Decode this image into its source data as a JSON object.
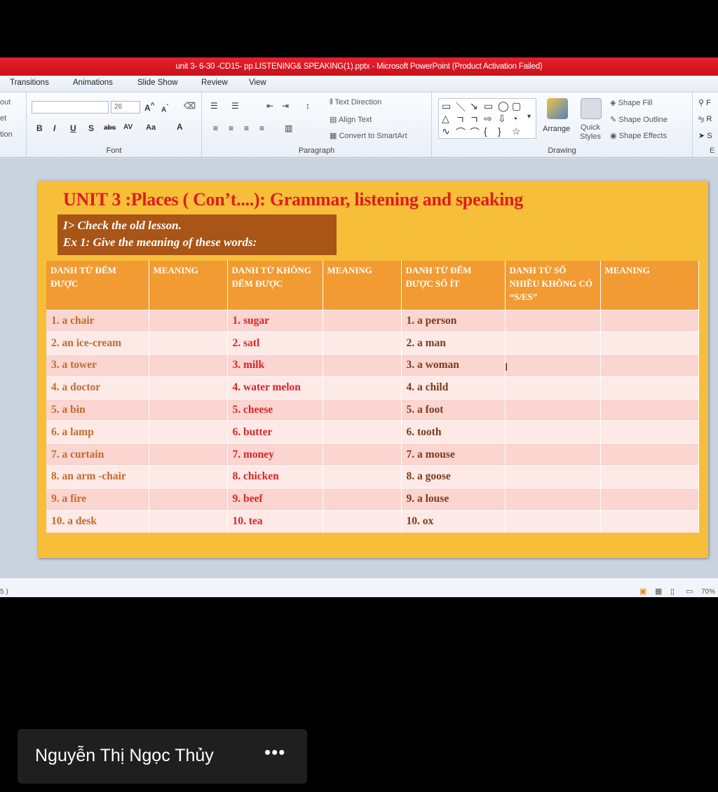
{
  "window": {
    "title": "unit 3- 6-30 -CD15- pp.LISTENING& SPEAKING(1).pptx  -  Microsoft PowerPoint (Product Activation Failed)"
  },
  "ribbon_tabs": [
    "Transitions",
    "Animations",
    "Slide Show",
    "Review",
    "View"
  ],
  "ribbon": {
    "left_partial": [
      "out",
      "et",
      "tion"
    ],
    "font_size": "26",
    "font_group_label": "Font",
    "paragraph": {
      "text_direction": "Text Direction",
      "align_text": "Align Text",
      "convert_smartart": "Convert to SmartArt",
      "label": "Paragraph"
    },
    "drawing": {
      "arrange": "Arrange",
      "quick_styles": "Quick Styles",
      "shape_fill": "Shape Fill",
      "shape_outline": "Shape Outline",
      "shape_effects": "Shape Effects",
      "label": "Drawing"
    },
    "editing_partial": [
      "F",
      "R",
      "S",
      "E"
    ]
  },
  "slide": {
    "title": "UNIT 3 :Places ( Con’t....): Grammar, listening and speaking",
    "subtitle_line1": "I> Check the old lesson.",
    "subtitle_line2": "Ex 1: Give the meaning of these words:",
    "headers": [
      "DANH TỪ ĐẾM ĐƯỢC",
      "MEANING",
      "DANH TỪ KHÔNG ĐẾM ĐƯỢC",
      "MEANING",
      "DANH TỪ ĐẾM ĐƯỢC SỐ ÍT",
      "DANH TỪ SỐ NHIỀU KHÔNG CÓ “S/ES”",
      "MEANING"
    ],
    "rows": [
      {
        "countable": "1. a chair",
        "uncountable": "1. sugar",
        "singular": "1. a person"
      },
      {
        "countable": "2. an ice-cream",
        "uncountable": "2. satl",
        "singular": "2. a man"
      },
      {
        "countable": "3. a tower",
        "uncountable": "3. milk",
        "singular": "3. a woman"
      },
      {
        "countable": "4. a doctor",
        "uncountable": "4. water melon",
        "singular": "4. a child"
      },
      {
        "countable": "5. a bin",
        "uncountable": "5. cheese",
        "singular": "5. a foot"
      },
      {
        "countable": "6. a lamp",
        "uncountable": "6. butter",
        "singular": "6. tooth"
      },
      {
        "countable": "7. a curtain",
        "uncountable": "7. money",
        "singular": "7. a mouse"
      },
      {
        "countable": "8. an arm -chair",
        "uncountable": "8. chicken",
        "singular": "8. a goose"
      },
      {
        "countable": "9. a fire",
        "uncountable": "9. beef",
        "singular": "9. a louse"
      },
      {
        "countable": "10.  a desk",
        "uncountable": "10. tea",
        "singular": "10. ox"
      }
    ]
  },
  "statusbar": {
    "slide_indicator": "5 )",
    "zoom": "70%"
  },
  "participant": {
    "name": "Nguyễn Thị Ngọc Thủy",
    "more_glyph": "•••"
  }
}
